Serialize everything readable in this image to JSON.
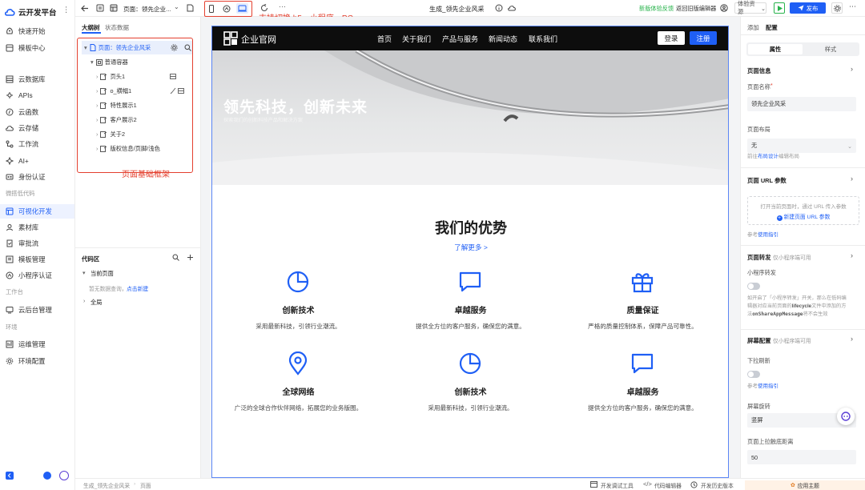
{
  "nav": {
    "brand": "云开发平台",
    "more": "⋮",
    "items": [
      {
        "label": "快速开始",
        "icon": "rocket-icon"
      },
      {
        "label": "模板中心",
        "icon": "template-icon"
      },
      {
        "label": "云数据库",
        "icon": "database-icon"
      },
      {
        "label": "APIs",
        "icon": "api-icon"
      },
      {
        "label": "云函数",
        "icon": "function-icon"
      },
      {
        "label": "云存储",
        "icon": "storage-icon"
      },
      {
        "label": "工作流",
        "icon": "workflow-icon"
      },
      {
        "label": "AI+",
        "icon": "ai-icon"
      },
      {
        "label": "身份认证",
        "icon": "id-icon"
      },
      {
        "label": "可视化开发",
        "icon": "visual-icon",
        "active": true
      },
      {
        "label": "素材库",
        "icon": "material-icon"
      },
      {
        "label": "审批流",
        "icon": "approval-icon"
      },
      {
        "label": "模板管理",
        "icon": "template-manage-icon"
      },
      {
        "label": "小程序认证",
        "icon": "miniapp-cert-icon"
      },
      {
        "label": "云后台管理",
        "icon": "admin-icon"
      },
      {
        "label": "运维管理",
        "icon": "ops-icon"
      },
      {
        "label": "环境配置",
        "icon": "env-icon"
      }
    ],
    "sections": [
      "微搭低代码",
      "工作台",
      "环境"
    ]
  },
  "toolbar": {
    "page_label": "页面：领先企业...",
    "page_chevron": "⌄",
    "more": "···",
    "device_annotation": "支持切换 h5、小程序、PC",
    "center_title": "生成_领先企业风采",
    "feedback": "新版体验反馈",
    "back_old": "返回旧版编辑器",
    "env_select": "体验资源",
    "publish": "发布"
  },
  "outline": {
    "tabs": [
      "大纲树",
      "状态数据"
    ],
    "rows": [
      {
        "label": "页面：领先企业风采",
        "level": 0,
        "selected": true
      },
      {
        "label": "普通容器",
        "level": 1
      },
      {
        "label": "页头1",
        "level": 2
      },
      {
        "label": "o_横幅1",
        "level": 2
      },
      {
        "label": "特性展示1",
        "level": 2
      },
      {
        "label": "客户展示2",
        "level": 2
      },
      {
        "label": "关于2",
        "level": 2
      },
      {
        "label": "版权信息/页脚/浅色",
        "level": 2
      }
    ],
    "annotation": "页面基础框架",
    "code": {
      "title": "代码区",
      "current_page": "当前页面",
      "empty_hint": "暂无数据查询，",
      "create_link": "点击新建",
      "global": "全局"
    }
  },
  "site": {
    "brand": "企业官网",
    "menu": [
      "首页",
      "关于我们",
      "产品与服务",
      "新闻动态",
      "联系我们"
    ],
    "login": "登录",
    "register": "注册",
    "hero_title": "领先科技，创新未来",
    "hero_sub": "探索我们的创新科技产品和解决方案",
    "section_title": "我们的优势",
    "more_link": "了解更多 >",
    "features": [
      {
        "title": "创新技术",
        "desc": "采用最新科技，引领行业潮流。",
        "icon": "pie-chart-icon"
      },
      {
        "title": "卓越服务",
        "desc": "提供全方位的客户服务，确保您的满意。",
        "icon": "chat-icon"
      },
      {
        "title": "质量保证",
        "desc": "严格的质量控制体系，保障产品可靠性。",
        "icon": "gift-icon"
      },
      {
        "title": "全球网络",
        "desc": "广泛的全球合作伙伴网络，拓展您的业务版图。",
        "icon": "location-icon"
      },
      {
        "title": "创新技术",
        "desc": "采用最新科技，引领行业潮流。",
        "icon": "pie-chart-icon"
      },
      {
        "title": "卓越服务",
        "desc": "提供全方位的客户服务，确保您的满意。",
        "icon": "chat-icon"
      }
    ]
  },
  "props": {
    "tabs": [
      "添加",
      "配置"
    ],
    "seg": [
      "属性",
      "样式"
    ],
    "page_info": "页面信息",
    "page_name_label": "页面名称",
    "page_name_value": "领先企业风采",
    "layout_label": "页面布局",
    "layout_value": "无",
    "layout_hint_pre": "前往",
    "layout_hint_link": "布局设计",
    "layout_hint_post": "编辑布局",
    "url_params": "页面 URL 参数",
    "url_hint": "打开当前页面时，通过 URL 传入参数",
    "url_new": "新建页面 URL 参数",
    "ref_pre": "参考",
    "ref_link": "使用指引",
    "forward_title": "页面转发",
    "forward_tag": "仅小程序端可用",
    "mini_forward": "小程序转发",
    "forward_hint_1": "如开启了「小程序转发」开关，那么在低码编",
    "forward_hint_2": "辑器对应当前页面的",
    "forward_hint_code1": "lifecycle",
    "forward_hint_3": "文件中添加的方",
    "forward_hint_4": "法",
    "forward_hint_code2": "onShareAppMessage",
    "forward_hint_5": "将不会生效",
    "screen_title": "屏幕配置",
    "screen_tag": "仅小程序端可用",
    "pull_refresh": "下拉刷新",
    "ref2_pre": "参考",
    "ref2_link": "使用指引",
    "rotate_label": "屏幕旋转",
    "rotate_value": "竖屏",
    "reach_label": "页面上拉触底距离",
    "reach_value": "50",
    "theme_btn": "应用主题"
  },
  "status": {
    "crumb1": "生成_领先企业风采",
    "crumb2": "页面",
    "debug": "开发调试工具",
    "code_editor": "代码编辑器",
    "history": "开发历史版本"
  },
  "colors": {
    "accent": "#1f5ff5",
    "annotation": "#e4402f",
    "green": "#27b34b"
  }
}
